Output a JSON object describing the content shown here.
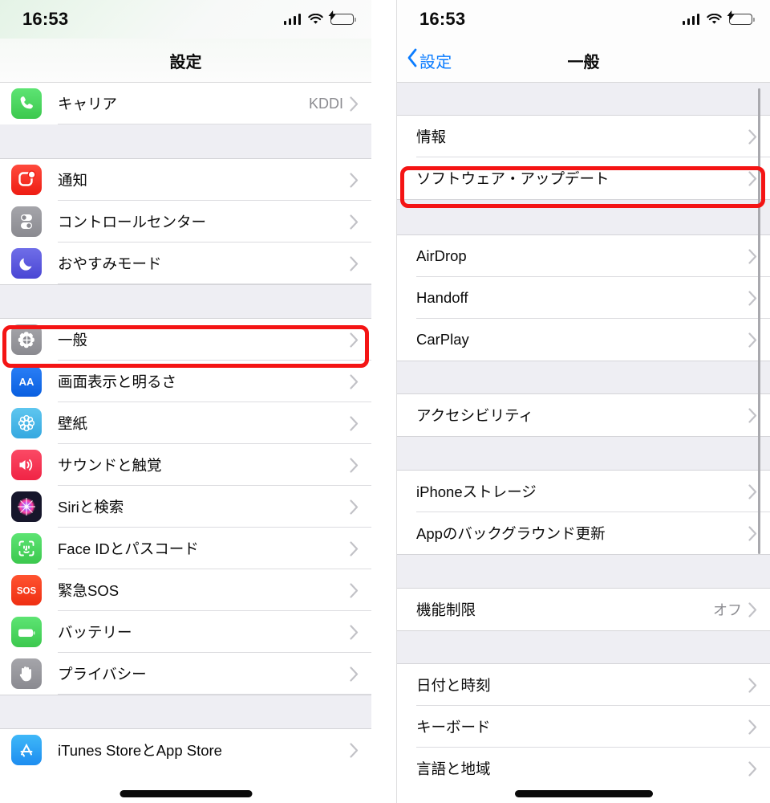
{
  "left_phone": {
    "status_bar": {
      "time": "16:53",
      "signal_icon": "cellular-bars-icon",
      "wifi_icon": "wifi-icon",
      "battery_icon": "battery-charging-icon",
      "battery_color": "#3bd755"
    },
    "nav": {
      "title": "設定"
    },
    "list": [
      {
        "kind": "row",
        "label": "キャリア",
        "value": "KDDI",
        "icon": "phone-icon",
        "icon_color": "#4cd964"
      },
      {
        "kind": "spacer"
      },
      {
        "kind": "row",
        "label": "通知",
        "value": "",
        "icon": "notifications-icon",
        "icon_color": "#ff3b30"
      },
      {
        "kind": "row",
        "label": "コントロールセンター",
        "value": "",
        "icon": "control-center-icon",
        "icon_color": "#8e8e93"
      },
      {
        "kind": "row",
        "label": "おやすみモード",
        "value": "",
        "icon": "moon-icon",
        "icon_color": "#5856d6"
      },
      {
        "kind": "spacer"
      },
      {
        "kind": "row",
        "label": "一般",
        "value": "",
        "icon": "gear-icon",
        "icon_color": "#8e8e93",
        "highlighted": true
      },
      {
        "kind": "row",
        "label": "画面表示と明るさ",
        "value": "",
        "icon": "display-brightness-icon",
        "icon_color": "#007aff"
      },
      {
        "kind": "row",
        "label": "壁紙",
        "value": "",
        "icon": "wallpaper-icon",
        "icon_color": "#4ab8e8"
      },
      {
        "kind": "row",
        "label": "サウンドと触覚",
        "value": "",
        "icon": "sound-haptics-icon",
        "icon_color": "#fa3c5a"
      },
      {
        "kind": "row",
        "label": "Siriと検索",
        "value": "",
        "icon": "siri-icon",
        "icon_color": "#1c1c2e"
      },
      {
        "kind": "row",
        "label": "Face IDとパスコード",
        "value": "",
        "icon": "face-id-icon",
        "icon_color": "#4cd964"
      },
      {
        "kind": "row",
        "label": "緊急SOS",
        "value": "",
        "icon": "emergency-sos-icon",
        "icon_color": "#ff3b30"
      },
      {
        "kind": "row",
        "label": "バッテリー",
        "value": "",
        "icon": "battery-icon",
        "icon_color": "#4cd964"
      },
      {
        "kind": "row",
        "label": "プライバシー",
        "value": "",
        "icon": "privacy-hand-icon",
        "icon_color": "#8e8e93"
      },
      {
        "kind": "spacer"
      },
      {
        "kind": "row",
        "label": "iTunes StoreとApp Store",
        "value": "",
        "icon": "app-store-icon",
        "icon_color": "#2fa5f5"
      }
    ],
    "home_indicator": true
  },
  "right_phone": {
    "status_bar": {
      "time": "16:53",
      "signal_icon": "cellular-bars-icon",
      "wifi_icon": "wifi-icon",
      "battery_icon": "battery-charging-icon",
      "battery_color": "#3bd755"
    },
    "nav": {
      "back_label": "設定",
      "back_icon": "chevron-left-icon",
      "title": "一般",
      "accent_color": "#0a7cff"
    },
    "list": [
      {
        "kind": "spacer"
      },
      {
        "kind": "row",
        "label": "情報",
        "value": ""
      },
      {
        "kind": "row",
        "label": "ソフトウェア・アップデート",
        "value": "",
        "highlighted": true
      },
      {
        "kind": "spacer"
      },
      {
        "kind": "row",
        "label": "AirDrop",
        "value": ""
      },
      {
        "kind": "row",
        "label": "Handoff",
        "value": ""
      },
      {
        "kind": "row",
        "label": "CarPlay",
        "value": ""
      },
      {
        "kind": "spacer"
      },
      {
        "kind": "row",
        "label": "アクセシビリティ",
        "value": ""
      },
      {
        "kind": "spacer"
      },
      {
        "kind": "row",
        "label": "iPhoneストレージ",
        "value": ""
      },
      {
        "kind": "row",
        "label": "Appのバックグラウンド更新",
        "value": ""
      },
      {
        "kind": "spacer"
      },
      {
        "kind": "row",
        "label": "機能制限",
        "value": "オフ"
      },
      {
        "kind": "spacer"
      },
      {
        "kind": "row",
        "label": "日付と時刻",
        "value": ""
      },
      {
        "kind": "row",
        "label": "キーボード",
        "value": ""
      },
      {
        "kind": "row",
        "label": "言語と地域",
        "value": ""
      }
    ],
    "scrollbar": true,
    "home_indicator": true
  },
  "highlight_color": "#f41414"
}
